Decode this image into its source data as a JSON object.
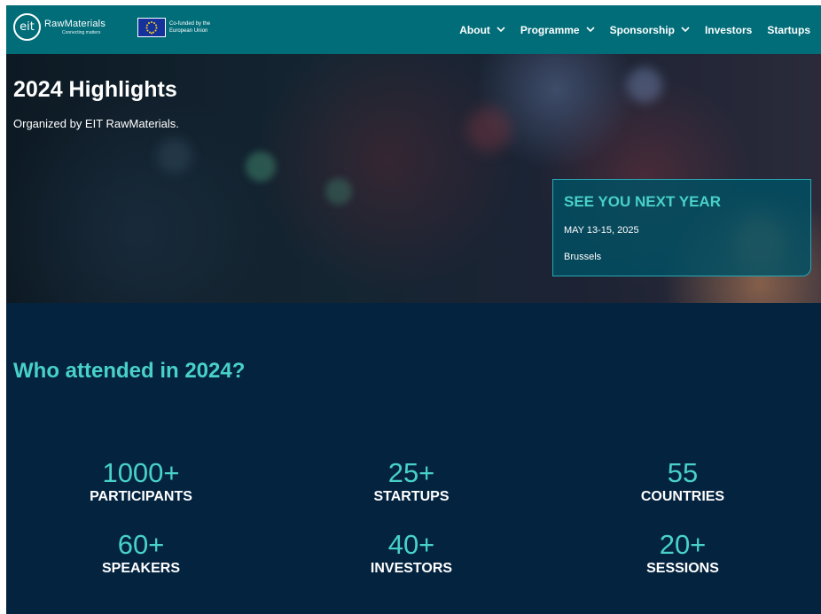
{
  "header": {
    "logo_mark": "eit",
    "logo_name": "RawMaterials",
    "logo_tagline": "Connecting matters",
    "eu_line1": "Co-funded by the",
    "eu_line2": "European Union",
    "nav": [
      {
        "label": "About",
        "dropdown": true
      },
      {
        "label": "Programme",
        "dropdown": true
      },
      {
        "label": "Sponsorship",
        "dropdown": true
      },
      {
        "label": "Investors",
        "dropdown": false
      },
      {
        "label": "Startups",
        "dropdown": false
      }
    ]
  },
  "hero": {
    "title": "2024 Highlights",
    "subtitle": "Organized by EIT RawMaterials.",
    "card": {
      "title": "SEE YOU NEXT YEAR",
      "date": "MAY 13-15, 2025",
      "location": "Brussels"
    }
  },
  "stats": {
    "title": "Who attended in 2024?",
    "items": [
      {
        "value": "1000+",
        "label": "PARTICIPANTS"
      },
      {
        "value": "25+",
        "label": "STARTUPS"
      },
      {
        "value": "55",
        "label": "COUNTRIES"
      },
      {
        "value": "60+",
        "label": "SPEAKERS"
      },
      {
        "value": "40+",
        "label": "INVESTORS"
      },
      {
        "value": "20+",
        "label": "SESSIONS"
      }
    ]
  },
  "colors": {
    "header_bg": "#006d79",
    "page_bg": "#04233f",
    "accent": "#48d1c8",
    "eu_blue": "#15319b"
  },
  "icons": {
    "logo": "eit-circle-logo",
    "eu_flag": "eu-flag-icon",
    "dropdown": "chevron-down-icon"
  }
}
